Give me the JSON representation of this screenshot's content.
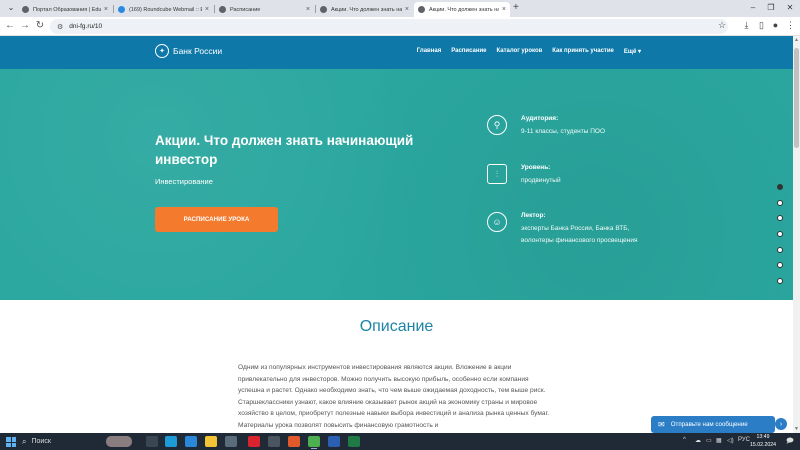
{
  "browser": {
    "tabs": [
      {
        "title": "Портал Образования | EduPo",
        "color": "#5f6368",
        "active": false
      },
      {
        "title": "(169) Roundcube Webmail :: Е",
        "color": "#2a8ae0",
        "active": false
      },
      {
        "title": "Расписание",
        "color": "#5f6368",
        "active": false
      },
      {
        "title": "Акции. Что должен знать нач",
        "color": "#5f6368",
        "active": false
      },
      {
        "title": "Акции. Что должен знать нач",
        "color": "#5f6368",
        "active": true
      }
    ],
    "url": "dni-fg.ru/10"
  },
  "site": {
    "brand": "Банк России",
    "menu": [
      "Главная",
      "Расписание",
      "Каталог уроков",
      "Как принять участие",
      "Ещё"
    ],
    "hero": {
      "title": "Акции. Что должен знать начинающий инвестор",
      "subtitle": "Инвестирование",
      "cta": "РАСПИСАНИЕ УРОКА"
    },
    "info": [
      {
        "label": "Аудитория:",
        "value": "9-11 классы, студенты ПОО",
        "icon": "audience-icon"
      },
      {
        "label": "Уровень:",
        "value": "продвинутый",
        "icon": "level-icon"
      },
      {
        "label": "Лектор:",
        "value": "эксперты Банка России, Банка ВТБ, волонтеры финансового просвещения",
        "icon": "lecturer-icon"
      }
    ],
    "description": {
      "title": "Описание",
      "text": "Одним из популярных инструментов инвестирования являются акции. Вложение в акции привлекательно для инвесторов. Можно получить высокую прибыль, особенно если компания успешна и растет. Однако необходимо знать, что чем выше ожидаемая доходность, тем выше риск. Старшеклассники узнают, какое влияние оказывает рынок акций на экономику страны и мировое хозяйство в целом, приобретут полезные навыки выбора инвестиций и анализа рынка ценных бумаг. Материалы урока позволят повысить финансовую грамотность и"
    },
    "chat": "Отправьте нам сообщение",
    "colors": {
      "header": "#0e78a8",
      "hero": "#2aa79f",
      "cta": "#f47a2e",
      "accent": "#1d84a6"
    }
  },
  "taskbar": {
    "search": "Поиск",
    "lang": "РУС",
    "time": "13:49",
    "date": "15.02.2024"
  }
}
